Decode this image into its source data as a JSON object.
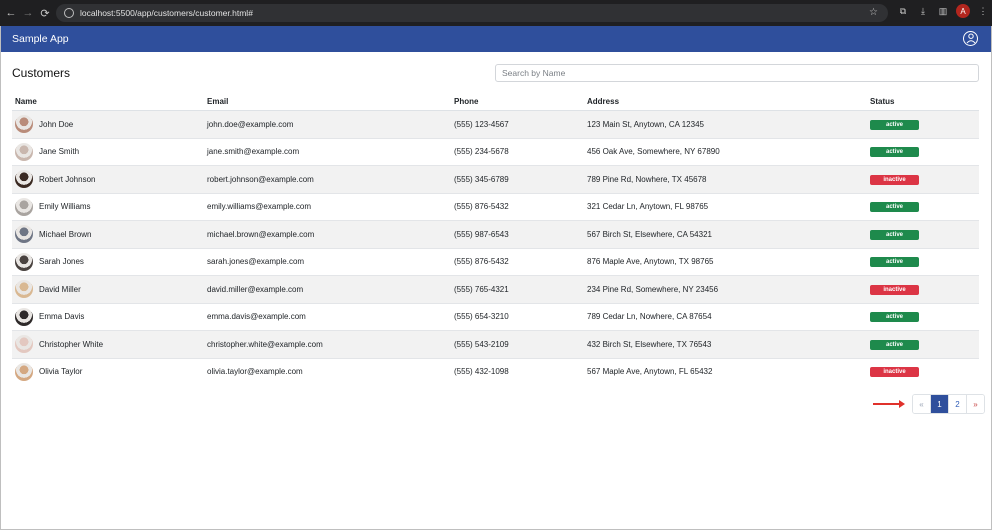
{
  "browser": {
    "url": "localhost:5500/app/customers/customer.html#",
    "profile_initial": "A"
  },
  "app": {
    "brand": "Sample App"
  },
  "page": {
    "title": "Customers",
    "search_placeholder": "Search by Name"
  },
  "table": {
    "headers": [
      "Name",
      "Email",
      "Phone",
      "Address",
      "Status"
    ],
    "rows": [
      {
        "name": "John Doe",
        "email": "john.doe@example.com",
        "phone": "(555) 123-4567",
        "address": "123 Main St, Anytown, CA 12345",
        "status": "active",
        "avatar_color": "#b98c7a"
      },
      {
        "name": "Jane Smith",
        "email": "jane.smith@example.com",
        "phone": "(555) 234-5678",
        "address": "456 Oak Ave, Somewhere, NY 67890",
        "status": "active",
        "avatar_color": "#c9b7ae"
      },
      {
        "name": "Robert Johnson",
        "email": "robert.johnson@example.com",
        "phone": "(555) 345-6789",
        "address": "789 Pine Rd, Nowhere, TX 45678",
        "status": "inactive",
        "avatar_color": "#3b2a22"
      },
      {
        "name": "Emily Williams",
        "email": "emily.williams@example.com",
        "phone": "(555) 876-5432",
        "address": "321 Cedar Ln, Anytown, FL 98765",
        "status": "active",
        "avatar_color": "#a9a4a0"
      },
      {
        "name": "Michael Brown",
        "email": "michael.brown@example.com",
        "phone": "(555) 987-6543",
        "address": "567 Birch St, Elsewhere, CA 54321",
        "status": "active",
        "avatar_color": "#6f7685"
      },
      {
        "name": "Sarah Jones",
        "email": "sarah.jones@example.com",
        "phone": "(555) 876-5432",
        "address": "876 Maple Ave, Anytown, TX 98765",
        "status": "active",
        "avatar_color": "#4a4340"
      },
      {
        "name": "David Miller",
        "email": "david.miller@example.com",
        "phone": "(555) 765-4321",
        "address": "234 Pine Rd, Somewhere, NY 23456",
        "status": "inactive",
        "avatar_color": "#d9b892"
      },
      {
        "name": "Emma Davis",
        "email": "emma.davis@example.com",
        "phone": "(555) 654-3210",
        "address": "789 Cedar Ln, Nowhere, CA 87654",
        "status": "active",
        "avatar_color": "#2e2a2a"
      },
      {
        "name": "Christopher White",
        "email": "christopher.white@example.com",
        "phone": "(555) 543-2109",
        "address": "432 Birch St, Elsewhere, TX 76543",
        "status": "active",
        "avatar_color": "#e3c8c0"
      },
      {
        "name": "Olivia Taylor",
        "email": "olivia.taylor@example.com",
        "phone": "(555) 432-1098",
        "address": "567 Maple Ave, Anytown, FL 65432",
        "status": "inactive",
        "avatar_color": "#d4a882"
      }
    ]
  },
  "pagination": {
    "prev": "«",
    "pages": [
      "1",
      "2"
    ],
    "current": "1",
    "next": "»"
  },
  "colors": {
    "navbar": "#2f4f9c",
    "active": "#1e8a4c",
    "inactive": "#dc3545",
    "annotation_arrow": "#e0312b"
  }
}
